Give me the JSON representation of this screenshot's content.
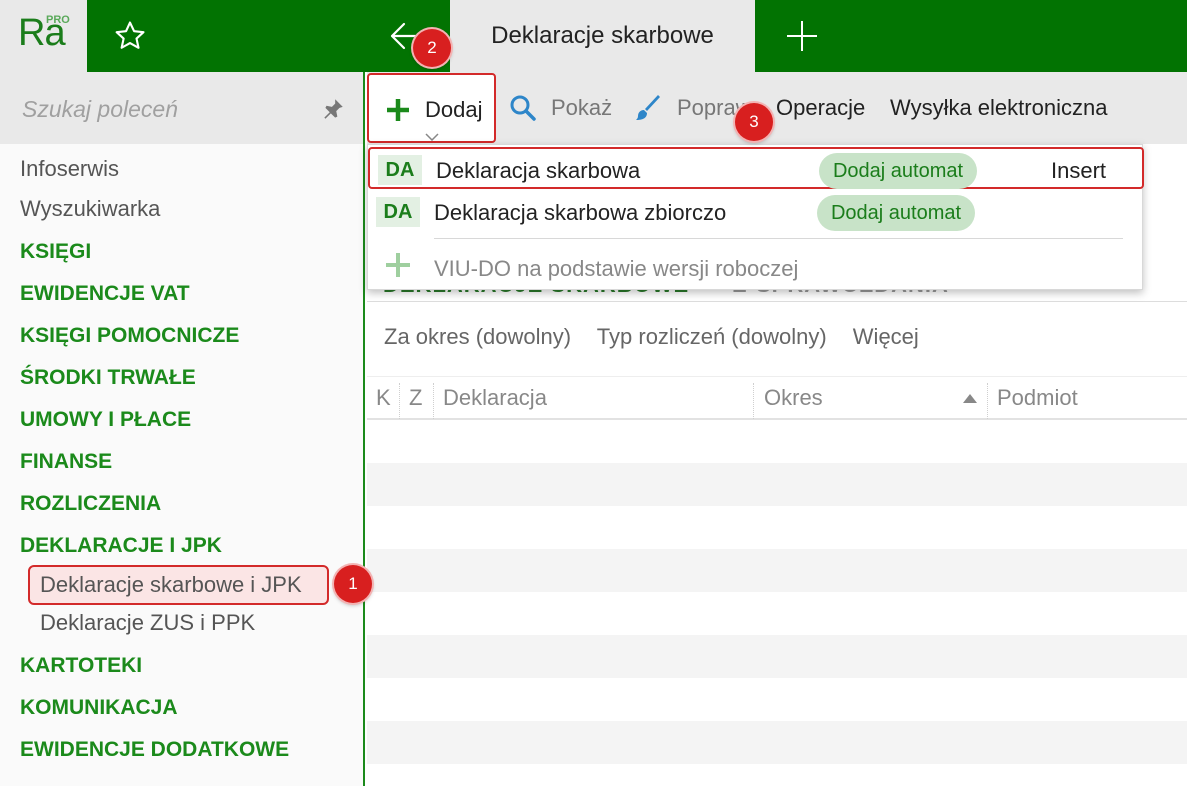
{
  "app": {
    "logo_text": "Ra",
    "logo_sup": "PRO",
    "active_tab": "Deklaracje skarbowe"
  },
  "search": {
    "placeholder": "Szukaj poleceń"
  },
  "sidebar": {
    "items": [
      {
        "label": "Infoserwis",
        "kind": "plain"
      },
      {
        "label": "Wyszukiwarka",
        "kind": "plain"
      },
      {
        "label": "KSIĘGI",
        "kind": "group"
      },
      {
        "label": "EWIDENCJE VAT",
        "kind": "group"
      },
      {
        "label": "KSIĘGI POMOCNICZE",
        "kind": "group"
      },
      {
        "label": "ŚRODKI TRWAŁE",
        "kind": "group"
      },
      {
        "label": "UMOWY I PŁACE",
        "kind": "group"
      },
      {
        "label": "FINANSE",
        "kind": "group"
      },
      {
        "label": "ROZLICZENIA",
        "kind": "group"
      },
      {
        "label": "DEKLARACJE I JPK",
        "kind": "group"
      },
      {
        "label": "Deklaracje skarbowe i JPK",
        "kind": "sub",
        "selected": true
      },
      {
        "label": "Deklaracje ZUS i PPK",
        "kind": "sub"
      },
      {
        "label": "KARTOTEKI",
        "kind": "group"
      },
      {
        "label": "KOMUNIKACJA",
        "kind": "group"
      },
      {
        "label": "EWIDENCJE DODATKOWE",
        "kind": "group"
      }
    ]
  },
  "toolbar": {
    "dodaj": "Dodaj",
    "pokaz": "Pokaż",
    "popraw": "Popraw",
    "operacje": "Operacje",
    "wysylka": "Wysyłka elektroniczna"
  },
  "dropdown": {
    "items": [
      {
        "code": "DA",
        "label": "Deklaracja skarbowa",
        "pill": "Dodaj automat",
        "shortcut": "Insert"
      },
      {
        "code": "DA",
        "label": "Deklaracja skarbowa zbiorczo",
        "pill": "Dodaj automat",
        "shortcut": ""
      }
    ],
    "extra_label": "VIU-DO na podstawie wersji roboczej"
  },
  "content": {
    "subtabs": [
      "DEKLARACJE SKARBOWE",
      "E-SPRAWOZDANIA"
    ],
    "filters": [
      "Za okres (dowolny)",
      "Typ rozliczeń (dowolny)",
      "Więcej"
    ],
    "columns": [
      "K",
      "Z",
      "Deklaracja",
      "Okres",
      "Podmiot"
    ]
  },
  "badges": [
    "1",
    "2",
    "3"
  ],
  "colors": {
    "brand_green": "#027302",
    "accent_green": "#1b8a1b",
    "highlight_red": "#d32a2a",
    "badge_red": "#d81f1f"
  }
}
